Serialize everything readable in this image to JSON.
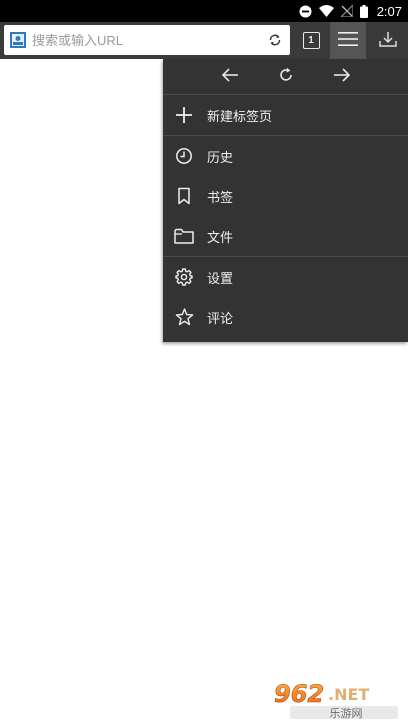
{
  "status_bar": {
    "time": "2:07",
    "icons": [
      "do-not-disturb-icon",
      "wifi-icon",
      "no-signal-icon",
      "battery-icon"
    ]
  },
  "toolbar": {
    "url_placeholder": "搜索或输入URL",
    "tab_count": "1"
  },
  "menu": {
    "nav": [
      "back-arrow-icon",
      "reload-icon",
      "forward-arrow-icon"
    ],
    "items": [
      {
        "label": "新建标签页",
        "icon": "plus-icon"
      },
      {
        "label": "历史",
        "icon": "clock-icon"
      },
      {
        "label": "书签",
        "icon": "bookmark-icon"
      },
      {
        "label": "文件",
        "icon": "folder-icon"
      },
      {
        "label": "设置",
        "icon": "gear-icon"
      },
      {
        "label": "评论",
        "icon": "star-icon"
      }
    ]
  },
  "watermark": {
    "brand": "962.NET",
    "subtitle": "乐游网"
  },
  "colors": {
    "toolbar": "#3a3a3a",
    "menu_bg": "#333333",
    "menu_button_active": "#555555",
    "status_bar": "#000000"
  }
}
